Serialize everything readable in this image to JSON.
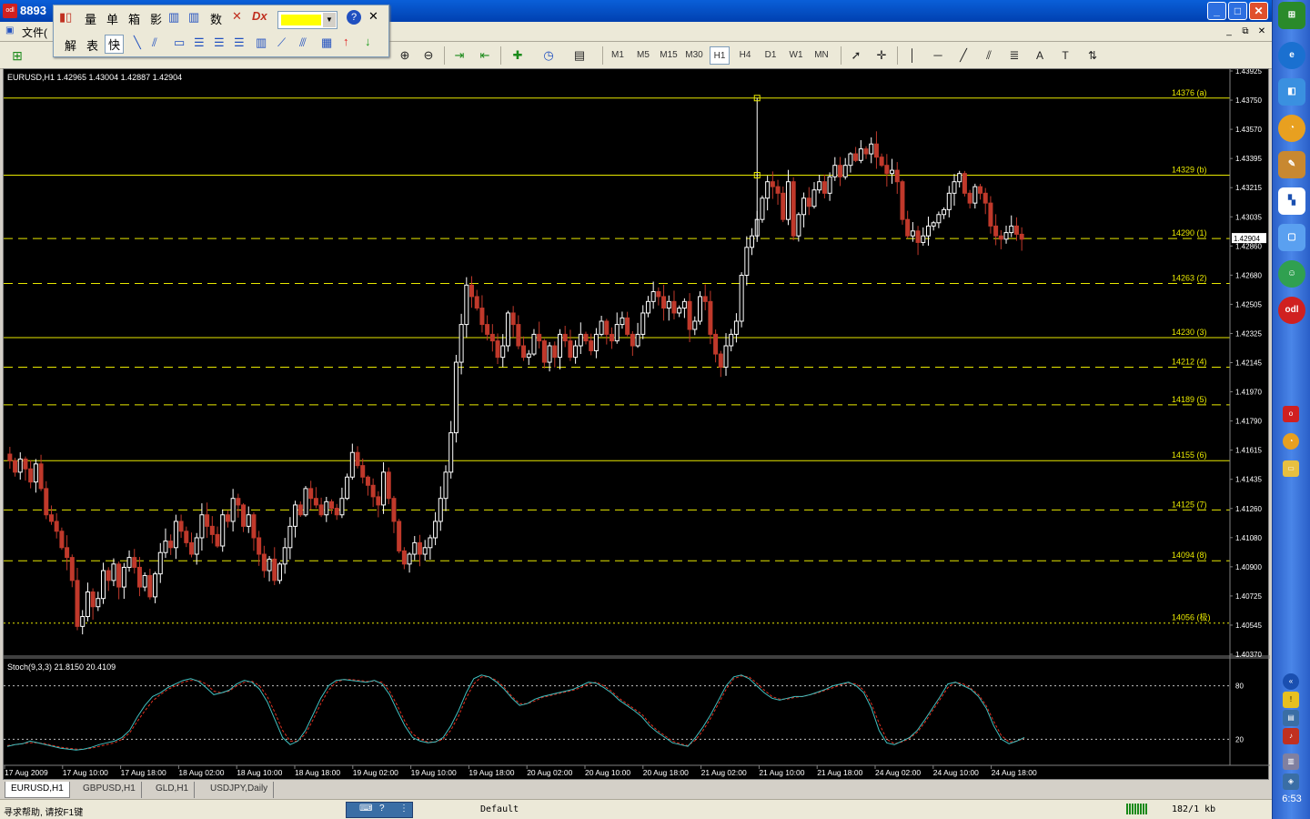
{
  "window": {
    "title": "8893",
    "menu_file": "文件(",
    "buttons": {
      "minimize": "_",
      "maximize": "□",
      "close": "✕",
      "mdi_min": "_",
      "mdi_restore": "⧉",
      "mdi_close": "✕"
    }
  },
  "draw_panel": {
    "row1": [
      "量",
      "单",
      "箱",
      "影",
      "数"
    ],
    "row2": [
      "解",
      "表",
      "快"
    ],
    "highlight_color": "#ffff00"
  },
  "timeframes": [
    "M1",
    "M5",
    "M15",
    "M30",
    "H1",
    "H4",
    "D1",
    "W1",
    "MN"
  ],
  "active_timeframe": "H1",
  "chart": {
    "header": "EURUSD,H1  1.42965 1.43004 1.42887 1.42904",
    "indicator_label": "Stoch(9,3,3) 21.8150 20.4109",
    "current_price_label": "1.42904",
    "price_axis": [
      "1.43925",
      "1.43750",
      "1.43570",
      "1.43395",
      "1.43215",
      "1.43035",
      "1.42860",
      "1.42680",
      "1.42505",
      "1.42325",
      "1.42145",
      "1.41970",
      "1.41790",
      "1.41615",
      "1.41435",
      "1.41260",
      "1.41080",
      "1.40900",
      "1.40725",
      "1.40545",
      "1.40370"
    ],
    "stoch_axis": [
      "80",
      "20"
    ],
    "time_axis": [
      "17 Aug 2009",
      "17 Aug 10:00",
      "17 Aug 18:00",
      "18 Aug 02:00",
      "18 Aug 10:00",
      "18 Aug 18:00",
      "19 Aug 02:00",
      "19 Aug 10:00",
      "19 Aug 18:00",
      "20 Aug 02:00",
      "20 Aug 10:00",
      "20 Aug 18:00",
      "21 Aug 02:00",
      "21 Aug 10:00",
      "21 Aug 18:00",
      "24 Aug 02:00",
      "24 Aug 10:00",
      "24 Aug 18:00"
    ],
    "levels": [
      {
        "label": "14376 (a)",
        "price": 1.4376,
        "style": "solid"
      },
      {
        "label": "14329 (b)",
        "price": 1.4329,
        "style": "solid"
      },
      {
        "label": "14290 (1)",
        "price": 1.42904,
        "style": "dash"
      },
      {
        "label": "14263 (2)",
        "price": 1.4263,
        "style": "dash"
      },
      {
        "label": "14230 (3)",
        "price": 1.423,
        "style": "solid"
      },
      {
        "label": "14212 (4)",
        "price": 1.4212,
        "style": "dash"
      },
      {
        "label": "14189 (5)",
        "price": 1.4189,
        "style": "dash"
      },
      {
        "label": "14155 (6)",
        "price": 1.4155,
        "style": "solid"
      },
      {
        "label": "14125 (7)",
        "price": 1.4125,
        "style": "dash"
      },
      {
        "label": "14094 (8)",
        "price": 1.4094,
        "style": "dash"
      },
      {
        "label": "14056 (极)",
        "price": 1.4056,
        "style": "dot"
      }
    ],
    "colors": {
      "bull": "#ffffff",
      "bear": "#c0392b",
      "level": "#e8e800",
      "stoch_main": "#40c0c0",
      "stoch_signal": "#e03020",
      "axis_text": "#ffffff"
    }
  },
  "chart_data": {
    "type": "candlestick",
    "symbol": "EURUSD",
    "timeframe": "H1",
    "ylim": [
      1.4037,
      1.43925
    ],
    "closes": [
      1.4155,
      1.4148,
      1.4156,
      1.415,
      1.4142,
      1.4153,
      1.4138,
      1.4122,
      1.4118,
      1.4112,
      1.4102,
      1.4096,
      1.4082,
      1.4054,
      1.406,
      1.4075,
      1.4066,
      1.4071,
      1.4088,
      1.4082,
      1.4092,
      1.4078,
      1.409,
      1.4096,
      1.409,
      1.4078,
      1.4085,
      1.4072,
      1.4086,
      1.4099,
      1.4106,
      1.4102,
      1.4118,
      1.4112,
      1.4105,
      1.4098,
      1.4108,
      1.4122,
      1.4115,
      1.411,
      1.4103,
      1.4122,
      1.4118,
      1.4132,
      1.4128,
      1.4115,
      1.4122,
      1.4108,
      1.4098,
      1.4088,
      1.4095,
      1.4082,
      1.4092,
      1.4102,
      1.4115,
      1.4128,
      1.4122,
      1.4138,
      1.4132,
      1.4128,
      1.4122,
      1.413,
      1.4126,
      1.4122,
      1.4132,
      1.4145,
      1.416,
      1.4152,
      1.4145,
      1.414,
      1.4133,
      1.4128,
      1.4148,
      1.4132,
      1.4118,
      1.41,
      1.4092,
      1.4098,
      1.4105,
      1.4098,
      1.4102,
      1.4108,
      1.4118,
      1.4132,
      1.4148,
      1.4172,
      1.4215,
      1.4238,
      1.4262,
      1.4255,
      1.4248,
      1.4238,
      1.4232,
      1.4228,
      1.4218,
      1.4225,
      1.4245,
      1.4238,
      1.4225,
      1.4218,
      1.422,
      1.4232,
      1.4228,
      1.4215,
      1.4225,
      1.4218,
      1.4232,
      1.4228,
      1.4218,
      1.4225,
      1.4232,
      1.4228,
      1.4222,
      1.4232,
      1.424,
      1.4232,
      1.4228,
      1.4238,
      1.4242,
      1.4232,
      1.4225,
      1.4232,
      1.4245,
      1.4252,
      1.4258,
      1.4255,
      1.4248,
      1.4252,
      1.4245,
      1.4248,
      1.4252,
      1.4235,
      1.424,
      1.4255,
      1.4252,
      1.4232,
      1.422,
      1.4212,
      1.4225,
      1.4232,
      1.424,
      1.4268,
      1.4285,
      1.4292,
      1.4302,
      1.4315,
      1.4325,
      1.4322,
      1.4318,
      1.4302,
      1.4325,
      1.4292,
      1.4305,
      1.4315,
      1.431,
      1.432,
      1.4325,
      1.4318,
      1.4328,
      1.4335,
      1.4328,
      1.4335,
      1.4342,
      1.4338,
      1.4345,
      1.4342,
      1.4348,
      1.434,
      1.4335,
      1.433,
      1.4332,
      1.4325,
      1.4302,
      1.4292,
      1.4295,
      1.4288,
      1.4292,
      1.4298,
      1.43,
      1.4305,
      1.4308,
      1.4318,
      1.4325,
      1.433,
      1.4318,
      1.4312,
      1.4322,
      1.4318,
      1.4312,
      1.4298,
      1.4292,
      1.429,
      1.4294,
      1.4298,
      1.4293,
      1.429
    ],
    "stoch_main": [
      12,
      14,
      15,
      18,
      16,
      14,
      12,
      10,
      9,
      8,
      9,
      11,
      14,
      16,
      18,
      22,
      30,
      45,
      58,
      68,
      72,
      78,
      82,
      86,
      88,
      85,
      78,
      70,
      72,
      75,
      82,
      86,
      84,
      76,
      62,
      42,
      22,
      14,
      18,
      30,
      48,
      66,
      80,
      86,
      87,
      86,
      85,
      84,
      86,
      82,
      70,
      52,
      35,
      22,
      18,
      16,
      17,
      22,
      35,
      52,
      72,
      88,
      92,
      90,
      84,
      76,
      66,
      58,
      60,
      65,
      68,
      70,
      72,
      74,
      76,
      80,
      84,
      83,
      78,
      72,
      64,
      58,
      52,
      45,
      35,
      28,
      22,
      16,
      14,
      12,
      22,
      34,
      48,
      64,
      80,
      90,
      92,
      88,
      80,
      72,
      66,
      64,
      66,
      68,
      68,
      70,
      73,
      76,
      80,
      82,
      84,
      80,
      72,
      55,
      30,
      16,
      14,
      18,
      22,
      30,
      42,
      55,
      68,
      82,
      84,
      80,
      76,
      68,
      55,
      35,
      20,
      15,
      18,
      22
    ],
    "stoch_signal": [
      13,
      14,
      15,
      16,
      16,
      15,
      13,
      11,
      10,
      9,
      9,
      10,
      12,
      14,
      16,
      20,
      27,
      40,
      52,
      63,
      70,
      76,
      80,
      84,
      86,
      86,
      82,
      74,
      72,
      74,
      80,
      84,
      85,
      80,
      68,
      50,
      30,
      18,
      18,
      26,
      42,
      60,
      75,
      84,
      87,
      87,
      86,
      85,
      85,
      84,
      74,
      58,
      40,
      26,
      20,
      17,
      17,
      20,
      30,
      46,
      66,
      82,
      90,
      90,
      86,
      78,
      68,
      60,
      60,
      63,
      67,
      69,
      71,
      73,
      75,
      78,
      82,
      84,
      80,
      74,
      66,
      60,
      54,
      48,
      38,
      30,
      24,
      18,
      15,
      13,
      19,
      30,
      44,
      60,
      76,
      88,
      91,
      90,
      83,
      75,
      68,
      65,
      65,
      67,
      68,
      70,
      72,
      75,
      78,
      81,
      83,
      82,
      75,
      60,
      38,
      20,
      15,
      17,
      21,
      28,
      39,
      52,
      65,
      78,
      84,
      82,
      77,
      70,
      58,
      40,
      24,
      17,
      18,
      21
    ]
  },
  "chart_tabs": [
    "EURUSD,H1",
    "GBPUSD,H1",
    "GLD,H1",
    "USDJPY,Daily"
  ],
  "status": {
    "help": "寻求帮助, 请按F1键",
    "profile": "Default",
    "traffic": "182/1 kb"
  },
  "sidebar": {
    "clock": "6:53"
  }
}
